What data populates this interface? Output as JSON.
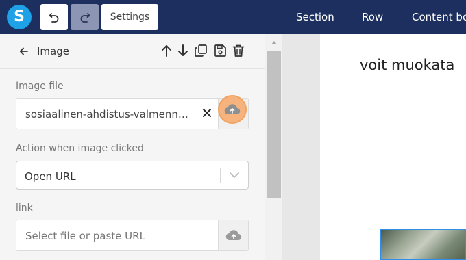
{
  "toolbar": {
    "logo_letter": "S",
    "undo_icon": "undo-icon",
    "redo_icon": "redo-icon",
    "settings_label": "Settings",
    "nav": [
      "Section",
      "Row",
      "Content bo"
    ]
  },
  "panel": {
    "back_icon": "arrow-left-icon",
    "title": "Image",
    "actions": [
      "move-up-icon",
      "move-down-icon",
      "duplicate-icon",
      "save-icon",
      "delete-icon"
    ],
    "image_file": {
      "label": "Image file",
      "value": "sosiaalinen-ahdistus-valmennus-verkko.jpg",
      "clear_icon": "close-icon",
      "upload_icon": "cloud-upload-icon"
    },
    "action": {
      "label": "Action when image clicked",
      "value": "Open URL",
      "chevron_icon": "chevron-down-icon"
    },
    "link": {
      "label": "link",
      "placeholder": "Select file or paste URL",
      "upload_icon": "cloud-upload-icon"
    }
  },
  "canvas": {
    "text": "voit muokata"
  },
  "colors": {
    "topbar": "#1c2f5e",
    "logo": "#1ea1e6",
    "redo_disabled": "#8c96b4",
    "highlight": "#f7a868",
    "selection": "#2f8ee5"
  }
}
